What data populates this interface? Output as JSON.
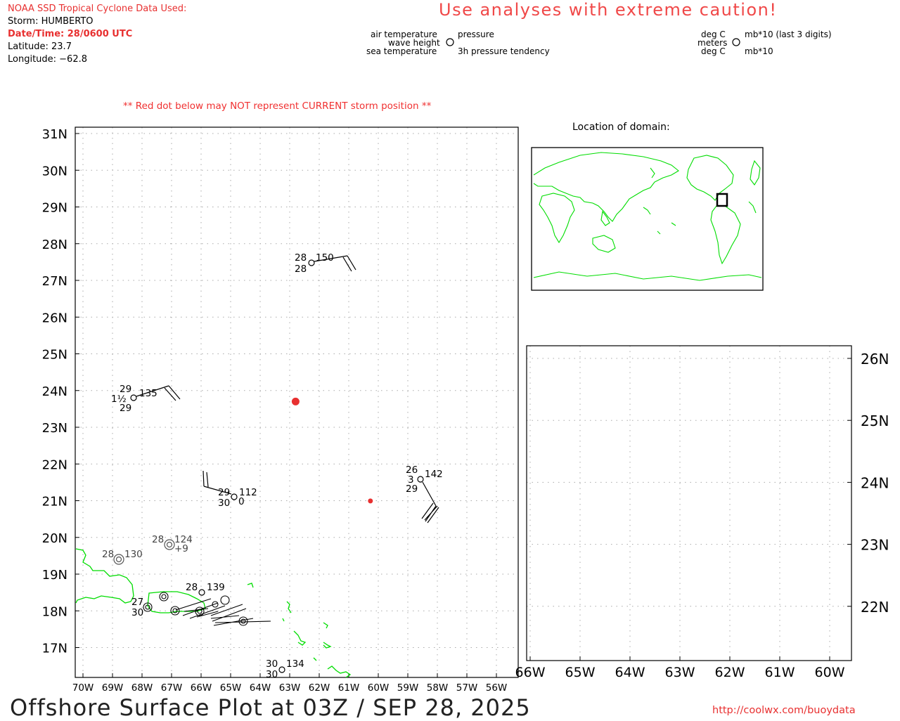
{
  "header": {
    "source_label": "NOAA SSD Tropical Cyclone Data Used:",
    "storm": "Storm: HUMBERTO",
    "datetime": "Date/Time: 28/0600 UTC",
    "latitude": "Latitude: 23.7",
    "longitude": "Longitude: −62.8",
    "caution": "Use analyses with extreme caution!"
  },
  "legend_left": {
    "air_temperature": "air temperature",
    "wave_height": "wave height",
    "sea_temperature": "sea temperature",
    "pressure": "pressure",
    "pressure_tendency": "3h pressure tendency"
  },
  "legend_right": {
    "deg_c_top": "deg C",
    "meters": "meters",
    "deg_c_bottom": "deg C",
    "mb_top": "mb*10 (last 3 digits)",
    "mb_bottom": "mb*10"
  },
  "notes": {
    "red_dot": "** Red dot below may NOT represent CURRENT storm position **",
    "domain_title": "Location of domain:"
  },
  "main_map": {
    "lat_labels": [
      "31N",
      "30N",
      "29N",
      "28N",
      "27N",
      "26N",
      "25N",
      "24N",
      "23N",
      "22N",
      "21N",
      "20N",
      "19N",
      "18N",
      "17N"
    ],
    "lon_labels": [
      "70W",
      "69W",
      "68W",
      "67W",
      "66W",
      "65W",
      "64W",
      "63W",
      "62W",
      "61W",
      "60W",
      "59W",
      "58W",
      "57W",
      "56W"
    ],
    "storm_position": {
      "lat": 23.7,
      "lon": -62.8
    }
  },
  "observations": [
    {
      "air_temp": "28",
      "pressure": "150",
      "sea_temp": "28"
    },
    {
      "air_temp": "29",
      "pressure": "135",
      "wave_height": "1½",
      "sea_temp": "29"
    },
    {
      "air_temp": "29",
      "pressure": "112",
      "sea_temp": "30",
      "tendency": "0"
    },
    {
      "air_temp": "26",
      "pressure": "142",
      "wave_height": "3",
      "sea_temp": "29"
    },
    {
      "air_temp": "28",
      "pressure": "124",
      "tendency": "+9"
    },
    {
      "air_temp": "28",
      "pressure": "130"
    },
    {
      "air_temp": "28",
      "pressure": "139"
    },
    {
      "air_temp": "30",
      "pressure": "134",
      "sea_temp": "30"
    },
    {
      "air_temp": "27",
      "sea_temp": "30"
    }
  ],
  "zoom_map": {
    "lat_labels": [
      "26N",
      "25N",
      "24N",
      "23N",
      "22N"
    ],
    "lon_labels": [
      "66W",
      "65W",
      "64W",
      "63W",
      "62W",
      "61W",
      "60W"
    ]
  },
  "footer": {
    "title": "Offshore Surface Plot at 03Z / SEP 28, 2025",
    "url": "http://coolwx.com/buoydata"
  },
  "colors": {
    "caution": "#f04848",
    "storm_dot": "#e83030",
    "coastline": "#00dd00"
  }
}
